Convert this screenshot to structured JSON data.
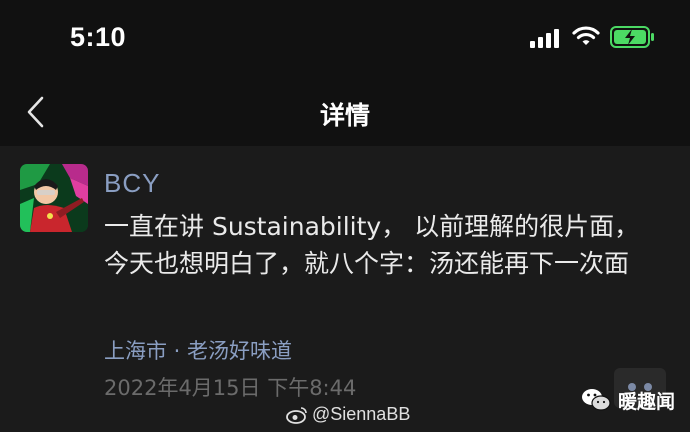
{
  "status_bar": {
    "time": "5:10",
    "icons": [
      "cellular-signal-icon",
      "wifi-icon",
      "battery-charging-icon"
    ],
    "battery_color": "#4cd964"
  },
  "nav": {
    "back_icon": "chevron-left-icon",
    "title": "详情"
  },
  "post": {
    "user_name": "BCY",
    "text": "一直在讲 Sustainability， 以前理解的很片面，今天也想明白了，就八个字：汤还能再下一次面",
    "location": "上海市 · 老汤好味道",
    "timestamp": "2022年4月15日 下午8:44",
    "more_icon": "more-dots-icon"
  },
  "watermarks": {
    "weibo_handle": "@SiennaBB",
    "wechat_name": "暖趣闻"
  },
  "colors": {
    "background": "#111111",
    "content_background": "#1b1b1b",
    "link": "#8a9ec2",
    "muted": "#6b6b6b"
  }
}
